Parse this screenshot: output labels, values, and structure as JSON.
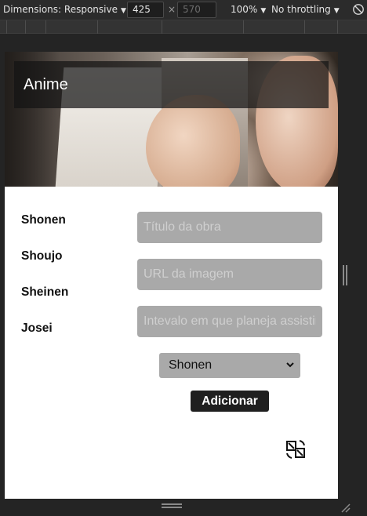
{
  "devtools": {
    "dimensions_label": "Dimensions: Responsive",
    "width_value": "425",
    "height_value": "570",
    "times_sign": "×",
    "zoom": "100%",
    "throttling": "No throttling"
  },
  "page": {
    "header_title": "Anime",
    "genres": [
      "Shonen",
      "Shoujo",
      "Sheinen",
      "Josei"
    ],
    "form": {
      "title_placeholder": "Título da obra",
      "image_url_placeholder": "URL da imagem",
      "interval_placeholder": "Intevalo em que planeja assistir",
      "genre_selected": "Shonen",
      "add_button_label": "Adicionar"
    }
  }
}
